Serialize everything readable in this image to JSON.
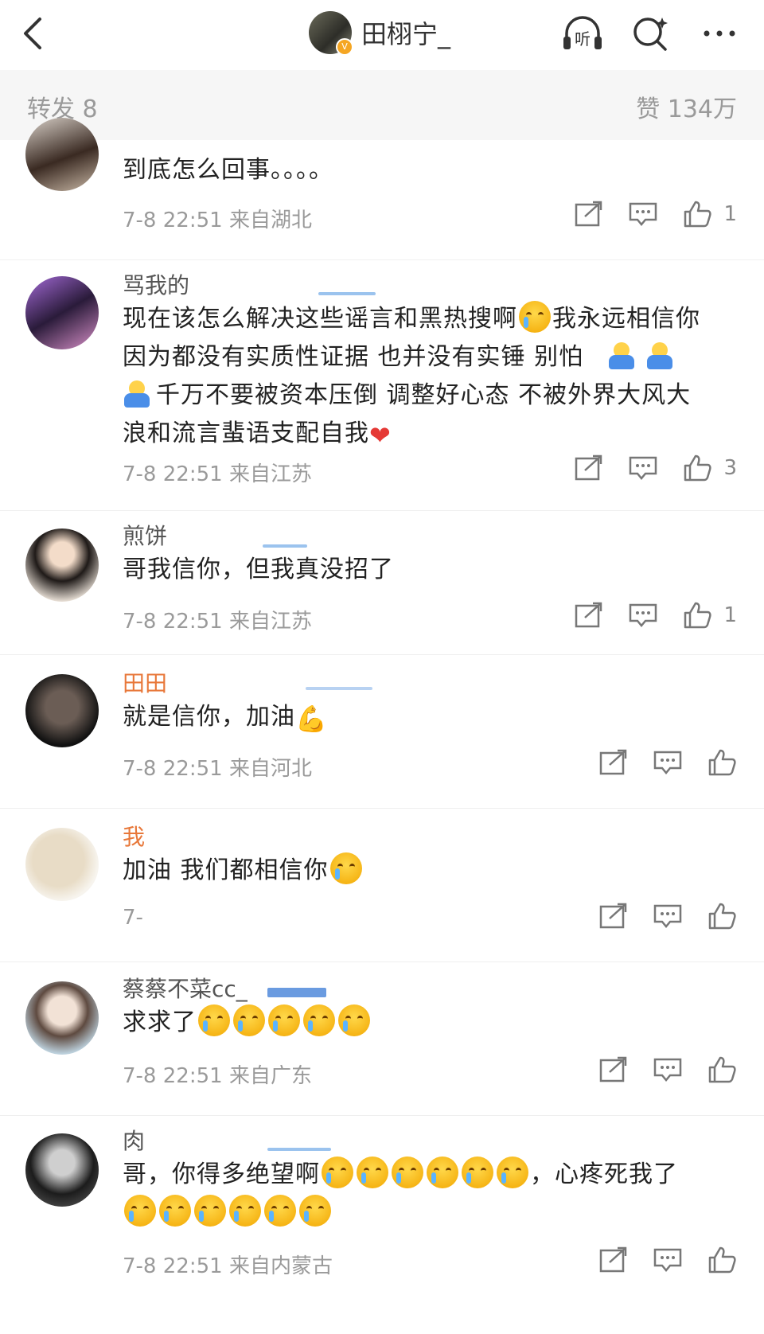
{
  "header": {
    "back_icon": "chevron-left-icon",
    "title": "田栩宁_",
    "icons": [
      "listen-icon",
      "search-icon",
      "more-icon"
    ],
    "listen_label": "听"
  },
  "stats": {
    "left": "转发 8",
    "right": "赞 134万"
  },
  "comments": [
    {
      "username": "",
      "text": "到底怎么回事。。。。",
      "time": "7-8 22:51",
      "location": "来自湖北",
      "likes": "1"
    },
    {
      "username": "骂我的",
      "text_a": "现在该怎么解决这些谣言和黑热搜啊",
      "text_b": "我永远相信你",
      "text_c": "因为都没有实质性证据 也并没有实锤 别怕",
      "text_d": "千万不要被资本压倒 调整好心态 不被外界大风大",
      "text_e": "浪和流言蜚语支配自我",
      "time": "7-8 22:51",
      "location": "来自江苏",
      "likes": "3"
    },
    {
      "username": "煎饼",
      "text": "哥我信你，但我真没招了",
      "time": "7-8 22:51",
      "location": "来自江苏",
      "likes": "1"
    },
    {
      "username": "田田",
      "text": "就是信你，加油",
      "time": "7-8 22:51",
      "location": "来自河北",
      "likes": ""
    },
    {
      "username": "我",
      "text": "加油 我们都相信你",
      "time": "7-",
      "location": "",
      "likes": ""
    },
    {
      "username": "蔡蔡不菜cc_",
      "text": "求求了",
      "time": "7-8 22:51",
      "location": "来自广东",
      "likes": ""
    },
    {
      "username": "肉",
      "text_a": "哥，你得多绝望啊",
      "text_b": "，心疼死我了",
      "time": "7-8 22:51",
      "location": "来自内蒙古",
      "likes": ""
    }
  ]
}
